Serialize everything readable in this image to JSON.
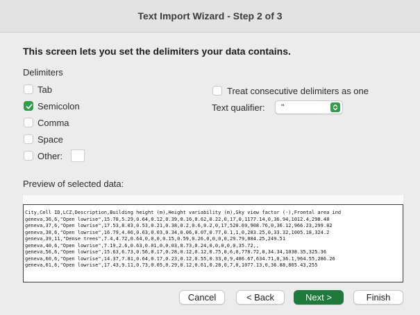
{
  "window": {
    "title": "Text Import Wizard - Step 2 of 3"
  },
  "heading": "This screen lets you set the delimiters your data contains.",
  "delimiters": {
    "label": "Delimiters",
    "options": [
      {
        "label": "Tab",
        "checked": false
      },
      {
        "label": "Semicolon",
        "checked": true
      },
      {
        "label": "Comma",
        "checked": false
      },
      {
        "label": "Space",
        "checked": false
      },
      {
        "label": "Other:",
        "checked": false
      }
    ],
    "other_value": ""
  },
  "consecutive": {
    "label": "Treat consecutive delimiters as one",
    "checked": false
  },
  "qualifier": {
    "label": "Text qualifier:",
    "value": "\""
  },
  "preview": {
    "label": "Preview of selected data:",
    "lines": [
      "City,Cell ID,LCZ,Description,Building height (m),Height variability (m),Sky view factor (-),Frontal area ind",
      "geneva,36,6,\"Open lowrise\",15.78,5.29,0.64,0.12,0.39,0.16,0.62,0.22,0,17,0,1177.14,0,36.94,1012.4,298.48",
      "geneva,37,6,\"Open lowrise\",17.53,8.03,0.53,0.21,0.38,0.2,0.6,0.2,0,17,520.69,908.76,0,36.12,966.23,299.82",
      "geneva,38,6,\"Open lowrise\",16.79,4.06,0.63,0.03,0.34,0.06,0.07,0.77,0.1,1,0,283.25,0,33.32,1005.18,324.2",
      "geneva,39,11,\"Dense trees\",7.4,4.72,0.64,0,0,0,0.15,0.59,0.26,0,0,0,0,29.79,884.25,249.51",
      "geneva,40,6,\"Open lowrise\",7.19,2.6,0.63,0.01,0,0.03,0.73,0.24,0,0,0,0,0,35.72,,",
      "geneva,56,6,\"Open lowrise\",15.63,6.73,0.56,0.17,0.28,0.12,0.12,0.75,0,6,0,778.72,0,34.34,1038.35,325.36",
      "geneva,60,6,\"Open lowrise\",14.37,7.81,0.64,0.17,0.23,0.12,0.55,0.33,0,9,486.67,634.71,0,36.1,964.55,286.26",
      "geneva,61,6,\"Open lowrise\",17.43,9.11,0.73,0.05,0.29,0.12,0.61,0.28,0,7,0,1077.13,0,36.88,865.43,255"
    ]
  },
  "buttons": {
    "cancel": "Cancel",
    "back": "< Back",
    "next": "Next >",
    "finish": "Finish"
  },
  "colors": {
    "accent": "#2f9e48",
    "primary_button": "#1e7a3a"
  }
}
